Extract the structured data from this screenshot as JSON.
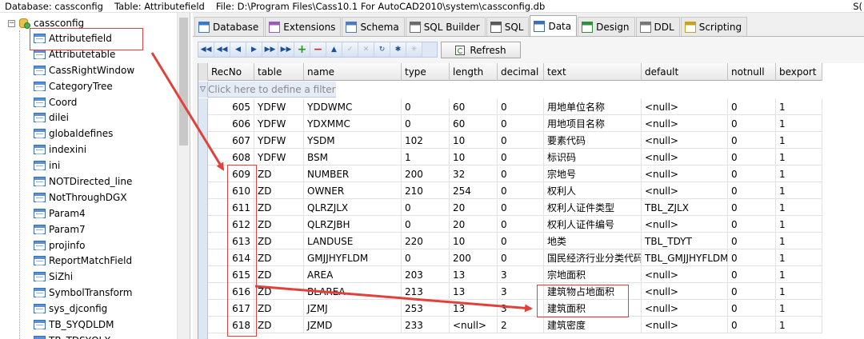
{
  "status": {
    "database": "Database: cassconfig",
    "table": "Table: Attributefield",
    "file": "File: D:\\Program Files\\Cass10.1 For AutoCAD2010\\system\\cassconfig.db",
    "suffix": "S("
  },
  "tree": {
    "root": "cassconfig",
    "items": [
      "Attributefield",
      "Attributetable",
      "CassRightWindow",
      "CategoryTree",
      "Coord",
      "dilei",
      "globaldefines",
      "indexini",
      "ini",
      "NOTDirected_line",
      "NotThroughDGX",
      "Param4",
      "Param7",
      "projinfo",
      "ReportMatchField",
      "SiZhi",
      "SymbolTransform",
      "sys_djconfig",
      "TB_SYQDLDM",
      "TB_TDSYQLX"
    ]
  },
  "tabs": [
    {
      "label": "Database",
      "icon": "database-icon"
    },
    {
      "label": "Extensions",
      "icon": "extensions-icon"
    },
    {
      "label": "Schema",
      "icon": "schema-icon"
    },
    {
      "label": "SQL Builder",
      "icon": "sql-builder-icon"
    },
    {
      "label": "SQL",
      "icon": "sql-icon"
    },
    {
      "label": "Data",
      "icon": "data-icon"
    },
    {
      "label": "Design",
      "icon": "design-icon"
    },
    {
      "label": "DDL",
      "icon": "ddl-icon"
    },
    {
      "label": "Scripting",
      "icon": "scripting-icon"
    }
  ],
  "toolbar": {
    "refresh_label": "Refresh"
  },
  "grid": {
    "columns": [
      "RecNo",
      "table",
      "name",
      "type",
      "length",
      "decimal",
      "text",
      "default",
      "notnull",
      "bexport"
    ],
    "filter_hint": "Click here to define a filter",
    "rows": [
      [
        "605",
        "YDFW",
        "YDDWMC",
        "0",
        "60",
        "0",
        "用地单位名称",
        "<null>",
        "0",
        "1"
      ],
      [
        "606",
        "YDFW",
        "YDXMMC",
        "0",
        "60",
        "0",
        "用地项目名称",
        "<null>",
        "0",
        "1"
      ],
      [
        "607",
        "YDFW",
        "YSDM",
        "102",
        "10",
        "0",
        "要素代码",
        "<null>",
        "0",
        "1"
      ],
      [
        "608",
        "YDFW",
        "BSM",
        "1",
        "10",
        "0",
        "标识码",
        "<null>",
        "0",
        "1"
      ],
      [
        "609",
        "ZD",
        "NUMBER",
        "200",
        "32",
        "0",
        "宗地号",
        "<null>",
        "0",
        "1"
      ],
      [
        "610",
        "ZD",
        "OWNER",
        "210",
        "254",
        "0",
        "权利人",
        "<null>",
        "0",
        "1"
      ],
      [
        "611",
        "ZD",
        "QLRZJLX",
        "0",
        "20",
        "0",
        "权利人证件类型",
        "TBL_ZJLX",
        "0",
        "1"
      ],
      [
        "612",
        "ZD",
        "QLRZJBH",
        "0",
        "20",
        "0",
        "权利人证件编号",
        "<null>",
        "0",
        "1"
      ],
      [
        "613",
        "ZD",
        "LANDUSE",
        "220",
        "10",
        "0",
        "地类",
        "TBL_TDYT",
        "0",
        "1"
      ],
      [
        "614",
        "ZD",
        "GMJJHYFLDM",
        "0",
        "200",
        "0",
        "国民经济行业分类代码",
        "TBL_GMJJHYFLDM",
        "0",
        "1"
      ],
      [
        "615",
        "ZD",
        "AREA",
        "203",
        "13",
        "3",
        "宗地面积",
        "<null>",
        "0",
        "1"
      ],
      [
        "616",
        "ZD",
        "BLAREA",
        "213",
        "13",
        "3",
        "建筑物占地面积",
        "<null>",
        "0",
        "1"
      ],
      [
        "617",
        "ZD",
        "JZMJ",
        "253",
        "13",
        "3",
        "建筑面积",
        "<null>",
        "0",
        "1"
      ],
      [
        "618",
        "ZD",
        "JZMD",
        "233",
        "<null>",
        "2",
        "建筑密度",
        "<null>",
        "0",
        "1"
      ]
    ]
  },
  "accent_colors": {
    "annotation": "#e0413a"
  }
}
